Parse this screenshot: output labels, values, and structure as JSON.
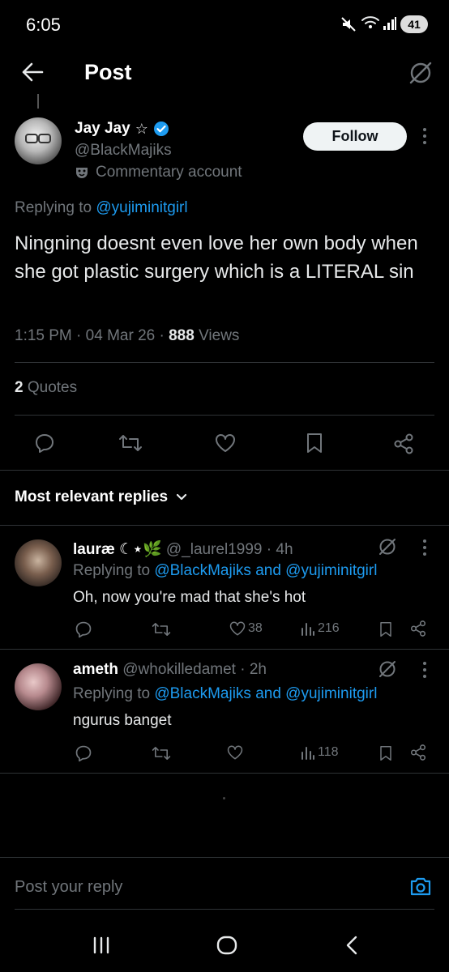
{
  "status_bar": {
    "time": "6:05",
    "battery": "41"
  },
  "header": {
    "title": "Post"
  },
  "post": {
    "author_name": "Jay Jay",
    "author_handle": "@BlackMajiks",
    "account_label": "Commentary account",
    "follow_label": "Follow",
    "replying_prefix": "Replying to",
    "replying_to": "@yujiminitgirl",
    "text": "Ningning doesnt even love her own body when she got plastic surgery which is a LITERAL sin",
    "time": "1:15 PM",
    "date": "04 Mar 26",
    "views_count": "888",
    "views_label": "Views",
    "quotes_count": "2",
    "quotes_label": "Quotes"
  },
  "replies_section": {
    "sort_label": "Most relevant replies"
  },
  "replies": [
    {
      "name": "lauræ ☾⋆🌿",
      "handle": "@_laurel1999",
      "time": "4h",
      "replying_prefix": "Replying to",
      "replying_to": "@BlackMajiks and @yujiminitgirl",
      "text": "Oh, now you're mad that she's hot",
      "likes": "38",
      "views": "216"
    },
    {
      "name": "ameth",
      "handle": "@whokilledamet",
      "time": "2h",
      "replying_prefix": "Replying to",
      "replying_to": "@BlackMajiks and @yujiminitgirl",
      "text": "ngurus banget",
      "likes": "",
      "views": "118"
    }
  ],
  "composer": {
    "placeholder": "Post your reply"
  },
  "colors": {
    "accent": "#1d9bf0",
    "background": "#000000",
    "muted": "#71767b"
  }
}
